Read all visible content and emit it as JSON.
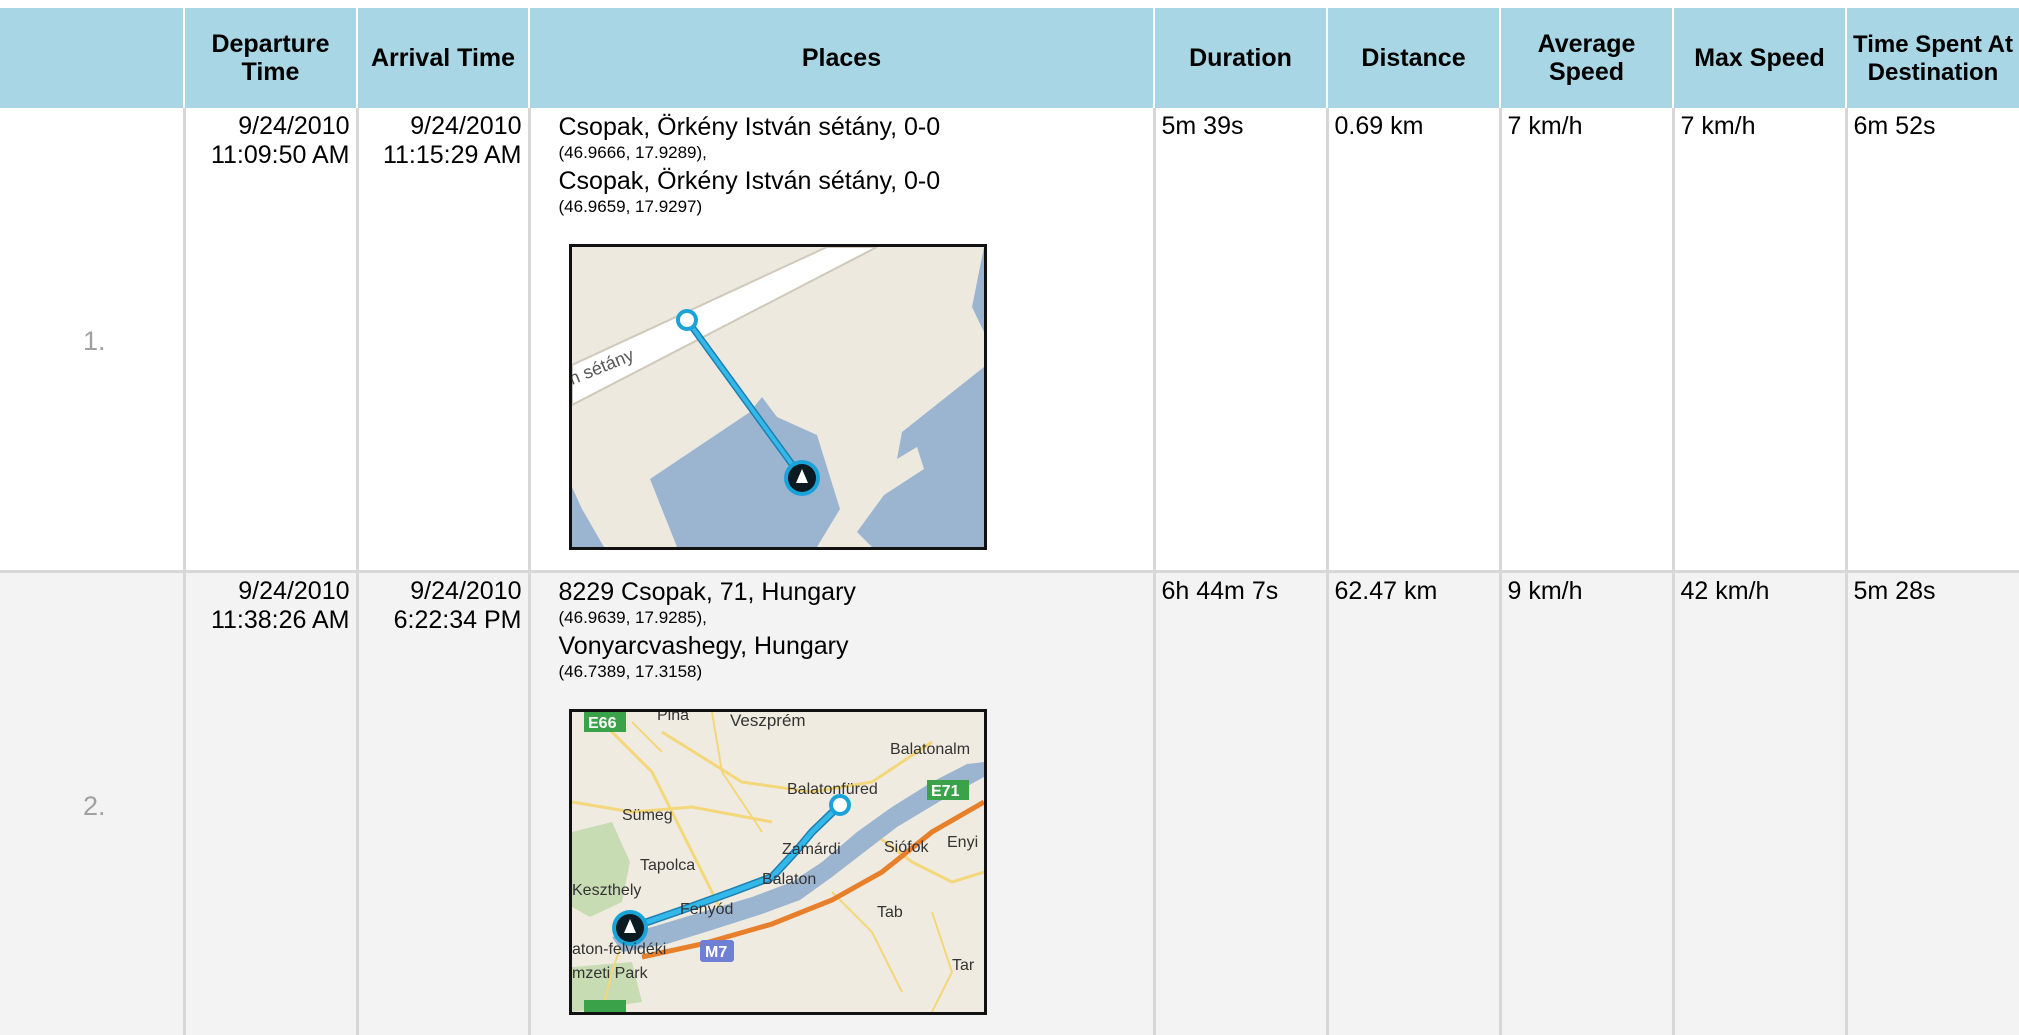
{
  "headers": {
    "departure": "Departure Time",
    "arrival": "Arrival Time",
    "places": "Places",
    "duration": "Duration",
    "distance": "Distance",
    "average_speed": "Average Speed",
    "max_speed": "Max Speed",
    "time_at_destination": "Time Spent At Destination"
  },
  "trips": [
    {
      "index": "1.",
      "departure_date": "9/24/2010",
      "departure_time": "11:09:50 AM",
      "arrival_date": "9/24/2010",
      "arrival_time": "11:15:29 AM",
      "from_name": "Csopak, Örkény István sétány, 0-0",
      "from_coord": "(46.9666, 17.9289),",
      "to_name": "Csopak, Örkény István sétány, 0-0",
      "to_coord": "(46.9659, 17.9297)",
      "duration": "5m 39s",
      "distance": "0.69 km",
      "average_speed": "7 km/h",
      "max_speed": "7 km/h",
      "time_at_destination": "6m 52s",
      "map": {
        "street_label": "n sétány"
      }
    },
    {
      "index": "2.",
      "departure_date": "9/24/2010",
      "departure_time": "11:38:26 AM",
      "arrival_date": "9/24/2010",
      "arrival_time": "6:22:34 PM",
      "from_name": "8229 Csopak, 71, Hungary",
      "from_coord": "(46.9639, 17.9285),",
      "to_name": "Vonyarcvashegy, Hungary",
      "to_coord": "(46.7389, 17.3158)",
      "duration": "6h 44m 7s",
      "distance": "62.47 km",
      "average_speed": "9 km/h",
      "max_speed": "42 km/h",
      "time_at_destination": "5m 28s",
      "map": {
        "labels": {
          "veszprem": "Veszprém",
          "balatonalm": "Balatonalm",
          "balatonfured": "Balatonfüred",
          "sumeg": "Sümeg",
          "tapolca": "Tapolca",
          "zamardi": "Zamárdi",
          "siofok": "Siófok",
          "enyi": "Enyi",
          "balaton": "Balaton",
          "keszthely": "Keszthely",
          "fenyod": "Fenyód",
          "tab": "Tab",
          "park1": "aton-felvidéki",
          "park2": "mzeti Park",
          "tar": "Tar",
          "e66": "E66",
          "e71": "E71",
          "m7": "M7",
          "pina": "Pina"
        }
      }
    }
  ],
  "colors": {
    "header_bg": "#a9d6e4",
    "row_alt_bg": "#f3f3f3",
    "route_line": "#1aa3d9",
    "water": "#9bb5d1",
    "road_green": "#3aa34a"
  }
}
